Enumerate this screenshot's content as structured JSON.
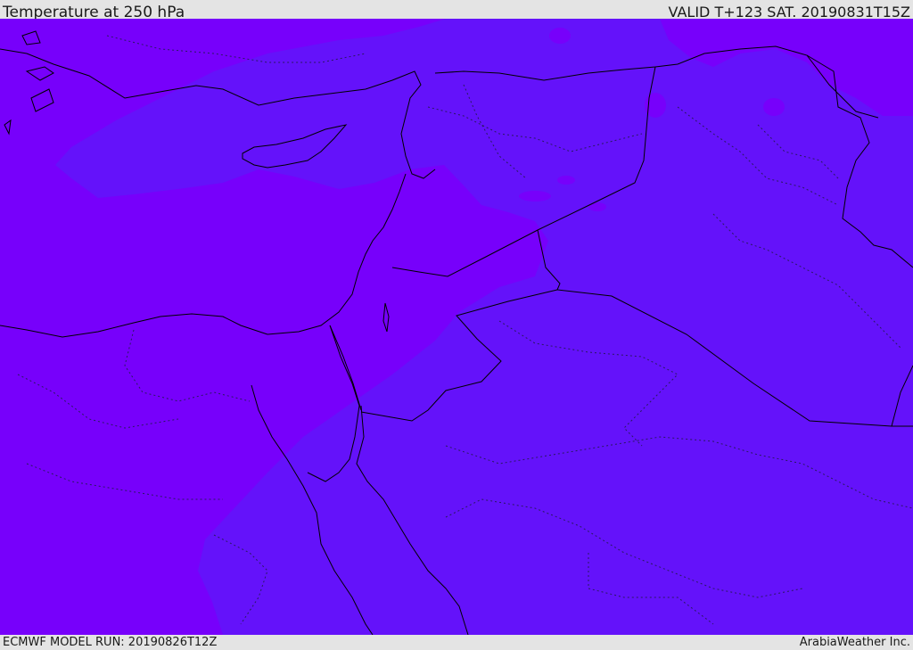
{
  "header": {
    "title": "Temperature at 250 hPa",
    "valid_time": "VALID T+123 SAT. 20190831T15Z"
  },
  "footer": {
    "model_run": "ECMWF MODEL RUN: 20190826T12Z",
    "credit": "ArabiaWeather Inc."
  },
  "map": {
    "field": "temperature-250hPa",
    "colors": {
      "warm_zone": "#7700fb",
      "cool_zone": "#6412fa",
      "coastline": "#000000",
      "internal_boundary": "#2a1860"
    }
  }
}
